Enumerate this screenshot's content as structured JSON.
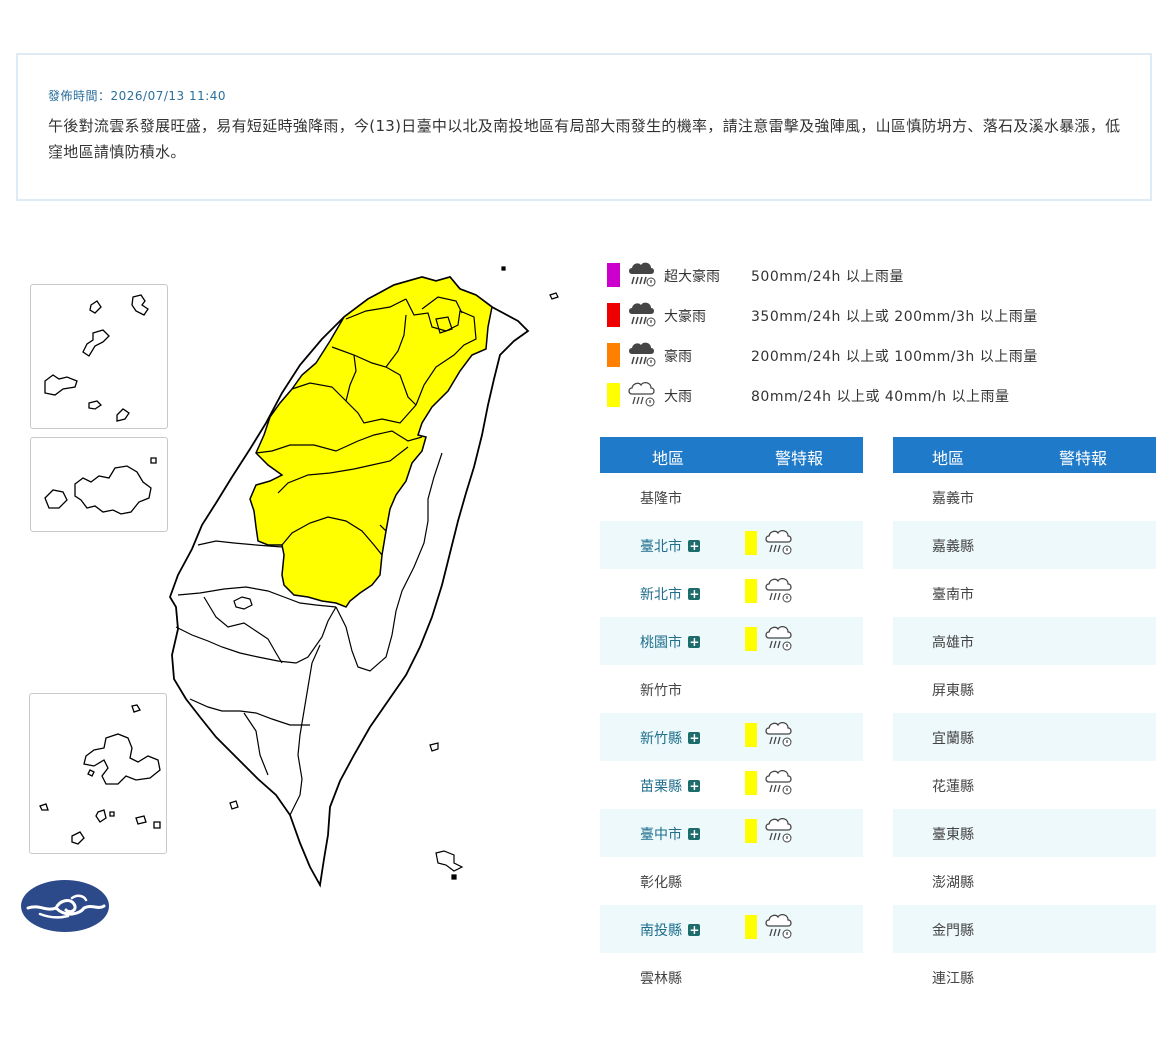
{
  "notice": {
    "time_label": "發佈時間：2026/07/13 11:40",
    "text": "午後對流雲系發展旺盛，易有短延時強降雨，今(13)日臺中以北及南投地區有局部大雨發生的機率，請注意雷擊及強陣風，山區慎防坍方、落石及溪水暴漲，低窪地區請慎防積水。"
  },
  "legend": [
    {
      "name": "超大豪雨",
      "desc": "500mm/24h 以上雨量",
      "color": "#cc00cc",
      "icon": "heavy-rain-storm-icon"
    },
    {
      "name": "大豪雨",
      "desc": "350mm/24h 以上或 200mm/3h 以上雨量",
      "color": "#ee0000",
      "icon": "heavy-rain-storm-icon"
    },
    {
      "name": "豪雨",
      "desc": "200mm/24h 以上或 100mm/3h 以上雨量",
      "color": "#ff7f00",
      "icon": "heavy-rain-storm-icon"
    },
    {
      "name": "大雨",
      "desc": "80mm/24h 以上或 40mm/h 以上雨量",
      "color": "#ffff00",
      "icon": "rain-warning-icon"
    }
  ],
  "table_headers": {
    "region": "地區",
    "warning": "警特報"
  },
  "left_regions": [
    {
      "name": "基隆市",
      "warning": false
    },
    {
      "name": "臺北市",
      "warning": true
    },
    {
      "name": "新北市",
      "warning": true
    },
    {
      "name": "桃園市",
      "warning": true
    },
    {
      "name": "新竹市",
      "warning": false
    },
    {
      "name": "新竹縣",
      "warning": true
    },
    {
      "name": "苗栗縣",
      "warning": true
    },
    {
      "name": "臺中市",
      "warning": true
    },
    {
      "name": "彰化縣",
      "warning": false
    },
    {
      "name": "南投縣",
      "warning": true
    },
    {
      "name": "雲林縣",
      "warning": false
    }
  ],
  "right_regions": [
    {
      "name": "嘉義市",
      "warning": false
    },
    {
      "name": "嘉義縣",
      "warning": false
    },
    {
      "name": "臺南市",
      "warning": false
    },
    {
      "name": "高雄市",
      "warning": false
    },
    {
      "name": "屏東縣",
      "warning": false
    },
    {
      "name": "宜蘭縣",
      "warning": false
    },
    {
      "name": "花蓮縣",
      "warning": false
    },
    {
      "name": "臺東縣",
      "warning": false
    },
    {
      "name": "澎湖縣",
      "warning": false
    },
    {
      "name": "金門縣",
      "warning": false
    },
    {
      "name": "連江縣",
      "warning": false
    }
  ],
  "colors": {
    "header_bg": "#1f7ac9",
    "warning_yellow": "#ffff00",
    "alt_row": "#eef9fb"
  }
}
